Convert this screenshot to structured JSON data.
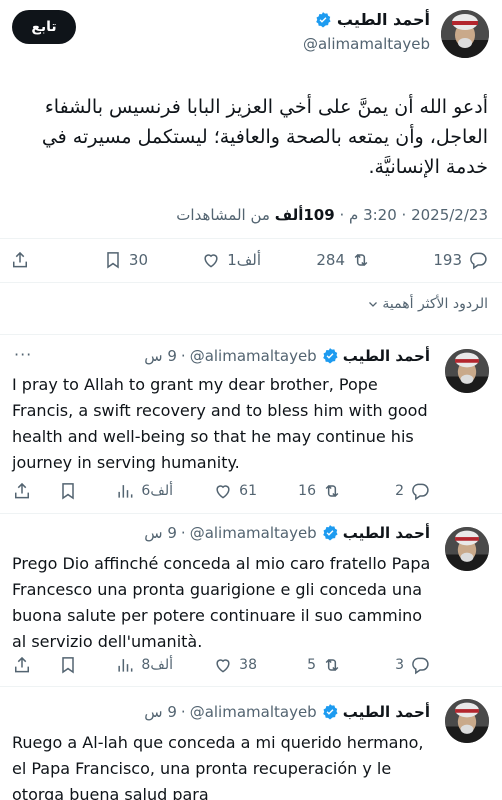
{
  "main_tweet": {
    "author_name": "أحمد الطيب",
    "handle": "@alimamaltayeb",
    "follow_label": "تابع",
    "text": "أدعو الله أن يمنَّ على أخي العزيز البابا فرنسيس بالشفاء العاجل، وأن يمتعه بالصحة والعافية؛ ليستكمل مسيرته في خدمة الإنسانيَّة.",
    "time": "3:20 م",
    "date": "2025/2/23",
    "views_count": "109ألف",
    "views_label": "من المشاهدات",
    "replies": "193",
    "reposts": "284",
    "likes": "1ألف",
    "bookmarks": "30"
  },
  "sort": {
    "label": "الردود الأكثر أهمية"
  },
  "replies": [
    {
      "author_name": "أحمد الطيب",
      "handle": "@alimamaltayeb",
      "time": "9 س",
      "text": "I pray to Allah to grant my dear brother, Pope Francis, a swift recovery and to bless him with good health and well-being so that he may continue his journey in serving humanity.",
      "replies": "2",
      "reposts": "16",
      "likes": "61",
      "views": "6ألف"
    },
    {
      "author_name": "أحمد الطيب",
      "handle": "@alimamaltayeb",
      "time": "9 س",
      "text": "Prego Dio affinché conceda al mio caro fratello Papa Francesco una pronta guarigione e gli conceda una buona salute per potere continuare il suo cammino al servizio dell'umanità.",
      "replies": "3",
      "reposts": "5",
      "likes": "38",
      "views": "8ألف"
    },
    {
      "author_name": "أحمد الطيب",
      "handle": "@alimamaltayeb",
      "time": "9 س",
      "text": "Ruego a Al-lah que conceda a mi querido hermano, el Papa Francisco, una pronta recuperación y le otorga buena salud para"
    }
  ],
  "colors": {
    "accent": "#1d9bf0",
    "muted": "#536471",
    "text": "#0f1419",
    "divider": "#eff3f4"
  }
}
